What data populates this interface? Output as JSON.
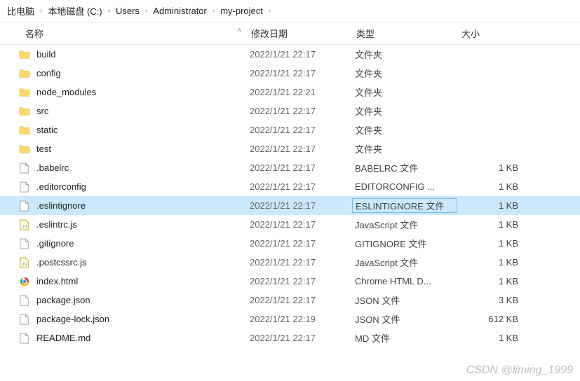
{
  "breadcrumbs": [
    "比电脑",
    "本地磁盘 (C:)",
    "Users",
    "Administrator",
    "my-project"
  ],
  "columns": {
    "name": "名称",
    "date": "修改日期",
    "type": "类型",
    "size": "大小"
  },
  "items": [
    {
      "icon": "folder",
      "name": "build",
      "date": "2022/1/21 22:17",
      "type": "文件夹",
      "size": ""
    },
    {
      "icon": "folder",
      "name": "config",
      "date": "2022/1/21 22:17",
      "type": "文件夹",
      "size": ""
    },
    {
      "icon": "folder",
      "name": "node_modules",
      "date": "2022/1/21 22:21",
      "type": "文件夹",
      "size": ""
    },
    {
      "icon": "folder",
      "name": "src",
      "date": "2022/1/21 22:17",
      "type": "文件夹",
      "size": ""
    },
    {
      "icon": "folder",
      "name": "static",
      "date": "2022/1/21 22:17",
      "type": "文件夹",
      "size": ""
    },
    {
      "icon": "folder",
      "name": "test",
      "date": "2022/1/21 22:17",
      "type": "文件夹",
      "size": ""
    },
    {
      "icon": "file",
      "name": ".babelrc",
      "date": "2022/1/21 22:17",
      "type": "BABELRC 文件",
      "size": "1 KB"
    },
    {
      "icon": "file",
      "name": ".editorconfig",
      "date": "2022/1/21 22:17",
      "type": "EDITORCONFIG ...",
      "size": "1 KB"
    },
    {
      "icon": "file",
      "name": ".eslintignore",
      "date": "2022/1/21 22:17",
      "type": "ESLINTIGNORE 文件",
      "size": "1 KB",
      "selected": true
    },
    {
      "icon": "js",
      "name": ".eslintrc.js",
      "date": "2022/1/21 22:17",
      "type": "JavaScript 文件",
      "size": "1 KB"
    },
    {
      "icon": "file",
      "name": ".gitignore",
      "date": "2022/1/21 22:17",
      "type": "GITIGNORE 文件",
      "size": "1 KB"
    },
    {
      "icon": "js",
      "name": ".postcssrc.js",
      "date": "2022/1/21 22:17",
      "type": "JavaScript 文件",
      "size": "1 KB"
    },
    {
      "icon": "chrome",
      "name": "index.html",
      "date": "2022/1/21 22:17",
      "type": "Chrome HTML D...",
      "size": "1 KB"
    },
    {
      "icon": "file",
      "name": "package.json",
      "date": "2022/1/21 22:17",
      "type": "JSON 文件",
      "size": "3 KB"
    },
    {
      "icon": "file",
      "name": "package-lock.json",
      "date": "2022/1/21 22:19",
      "type": "JSON 文件",
      "size": "612 KB"
    },
    {
      "icon": "file",
      "name": "README.md",
      "date": "2022/1/21 22:17",
      "type": "MD 文件",
      "size": "1 KB"
    }
  ],
  "watermark": "CSDN @liming_1999"
}
